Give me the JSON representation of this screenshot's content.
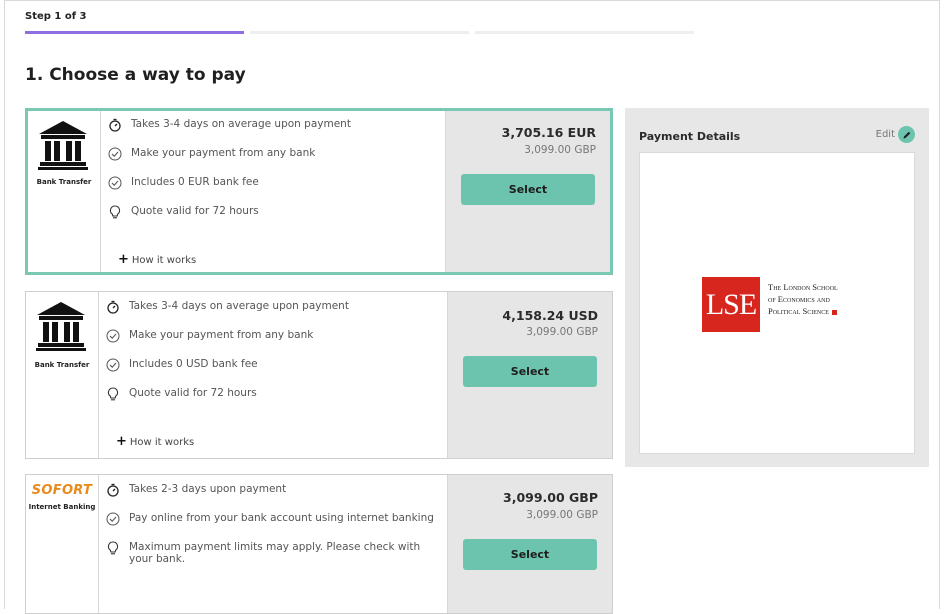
{
  "step_label": "Step 1 of 3",
  "section_title": "1. Choose a way to pay",
  "accent_color": "#8f6fe0",
  "brand_color": "#6cc4ae",
  "options": [
    {
      "logo_label": "Bank Transfer",
      "logo_icon": "bank-icon",
      "features": [
        {
          "icon": "stopwatch-icon",
          "text": "Takes 3-4 days on average upon payment"
        },
        {
          "icon": "check-circle-icon",
          "text": "Make your payment from any bank"
        },
        {
          "icon": "check-circle-icon",
          "text": "Includes 0 EUR bank fee"
        },
        {
          "icon": "lightbulb-icon",
          "text": "Quote valid for 72 hours"
        }
      ],
      "how_it_works": "How it works",
      "price": "3,705.16 EUR",
      "price_sub": "3,099.00 GBP",
      "select_label": "Select"
    },
    {
      "logo_label": "Bank Transfer",
      "logo_icon": "bank-icon",
      "features": [
        {
          "icon": "stopwatch-icon",
          "text": "Takes 3-4 days on average upon payment"
        },
        {
          "icon": "check-circle-icon",
          "text": "Make your payment from any bank"
        },
        {
          "icon": "check-circle-icon",
          "text": "Includes 0 USD bank fee"
        },
        {
          "icon": "lightbulb-icon",
          "text": "Quote valid for 72 hours"
        }
      ],
      "how_it_works": "How it works",
      "price": "4,158.24 USD",
      "price_sub": "3,099.00 GBP",
      "select_label": "Select"
    },
    {
      "logo_brand": "SOFORT",
      "logo_label": "Internet Banking",
      "features": [
        {
          "icon": "stopwatch-icon",
          "text": "Takes 2-3 days upon payment"
        },
        {
          "icon": "check-circle-icon",
          "text": "Pay online from your bank account using internet banking"
        },
        {
          "icon": "lightbulb-icon",
          "text": "Maximum payment limits may apply. Please check with your bank."
        }
      ],
      "price": "3,099.00 GBP",
      "price_sub": "3,099.00 GBP",
      "select_label": "Select"
    }
  ],
  "details": {
    "title": "Payment Details",
    "edit_label": "Edit",
    "institution_mark": "LSE",
    "institution_line1": "The London School",
    "institution_line2": "of Economics and",
    "institution_line3": "Political Science"
  }
}
